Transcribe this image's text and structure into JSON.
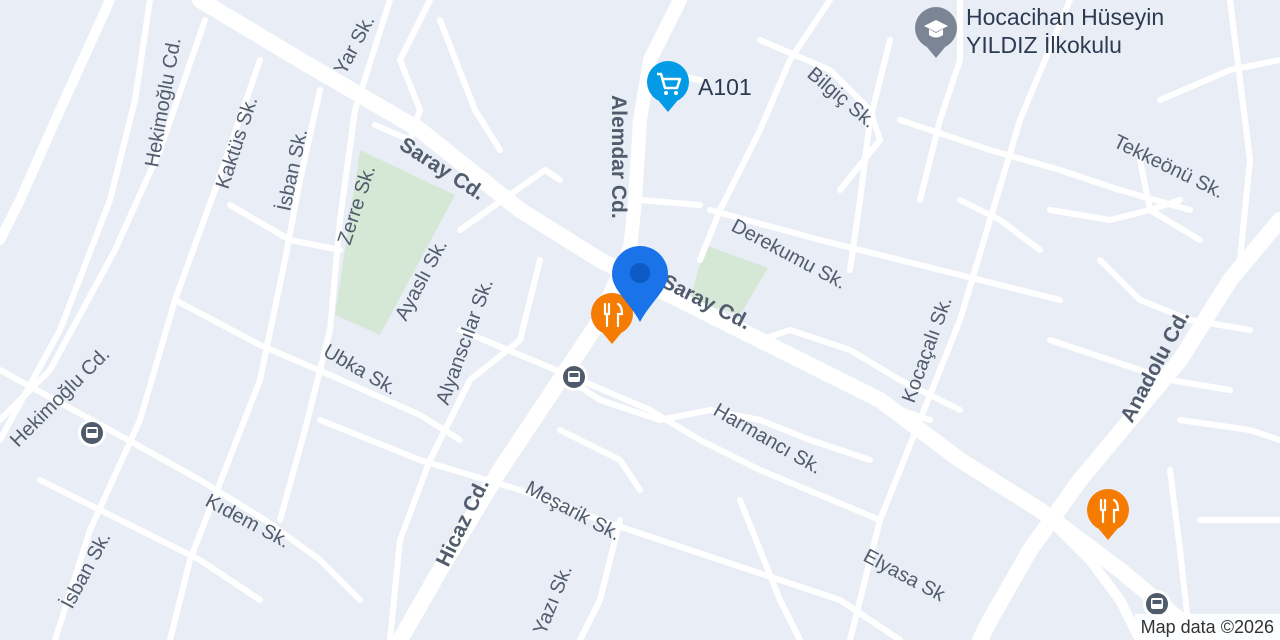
{
  "map": {
    "colors": {
      "background": "#e9edf6",
      "road": "#ffffff",
      "park": "#d5e8d6",
      "label": "#515c6d",
      "restaurant_pin": "#f57c00",
      "shop_pin": "#039be5",
      "school_pin": "#7b8594",
      "transit_pin": "#4f5b6a",
      "location_marker": "#1a73e8"
    },
    "roads": [
      {
        "name": "Saray Cd.",
        "kind": "major"
      },
      {
        "name": "Saray Cd.",
        "kind": "major"
      },
      {
        "name": "Alemdar Cd.",
        "kind": "major"
      },
      {
        "name": "Hicaz Cd.",
        "kind": "major"
      },
      {
        "name": "Anadolu Cd.",
        "kind": "major"
      },
      {
        "name": "Hekimoğlu Cd.",
        "kind": "street"
      },
      {
        "name": "Hekimoğlu Cd.",
        "kind": "street"
      },
      {
        "name": "Kaktüs Sk.",
        "kind": "street"
      },
      {
        "name": "İsban Sk.",
        "kind": "street"
      },
      {
        "name": "İsban Sk.",
        "kind": "street"
      },
      {
        "name": "Yar Sk.",
        "kind": "street"
      },
      {
        "name": "Zerre Sk.",
        "kind": "street"
      },
      {
        "name": "Ayaslı Sk.",
        "kind": "street"
      },
      {
        "name": "Alyanscılar Sk.",
        "kind": "street"
      },
      {
        "name": "Ubka Sk.",
        "kind": "street"
      },
      {
        "name": "Kıdem Sk.",
        "kind": "street"
      },
      {
        "name": "Meşarik Sk.",
        "kind": "street"
      },
      {
        "name": "Yazı Sk.",
        "kind": "street"
      },
      {
        "name": "Harmancı Sk.",
        "kind": "street"
      },
      {
        "name": "Elyasa Sk",
        "kind": "street"
      },
      {
        "name": "Derekumu Sk.",
        "kind": "street"
      },
      {
        "name": "Bilgiç Sk.",
        "kind": "street"
      },
      {
        "name": "Kocaçalı Sk.",
        "kind": "street"
      },
      {
        "name": "Tekkeönü Sk.",
        "kind": "street"
      }
    ],
    "pois": [
      {
        "name": "A101",
        "icon": "shopping-cart-icon",
        "category": "shop"
      },
      {
        "name_line1": "Hocacihan Hüseyin",
        "name_line2": "YILDIZ İlkokulu",
        "icon": "school-icon",
        "category": "school"
      },
      {
        "name": "",
        "icon": "restaurant-icon",
        "category": "restaurant"
      },
      {
        "name": "",
        "icon": "restaurant-icon",
        "category": "restaurant"
      }
    ],
    "transit_stops": [
      {
        "icon": "bus-stop-icon"
      },
      {
        "icon": "bus-stop-icon"
      },
      {
        "icon": "bus-stop-icon"
      }
    ],
    "marker": {
      "icon": "location-pin-icon"
    },
    "attribution": "Map data ©2026"
  }
}
